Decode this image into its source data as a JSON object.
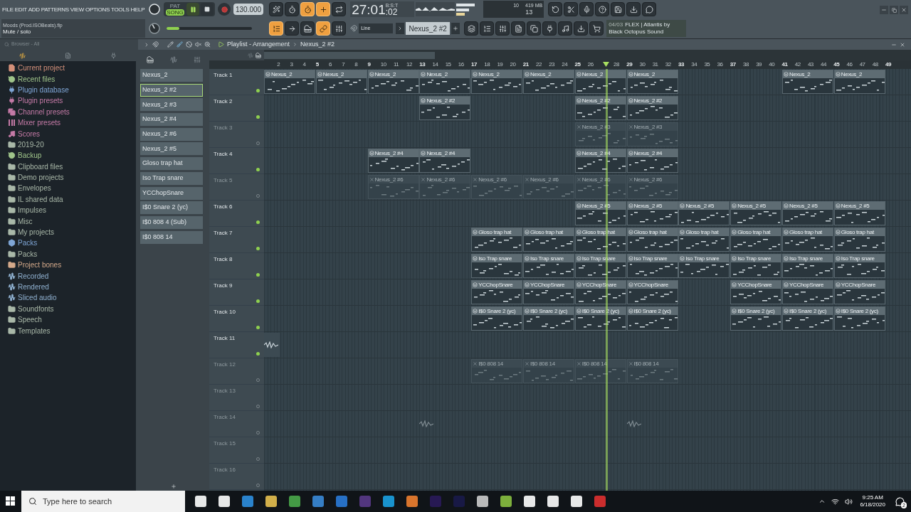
{
  "menu": [
    "FILE",
    "EDIT",
    "ADD",
    "PATTERNS",
    "VIEW",
    "OPTIONS",
    "TOOLS",
    "HELP"
  ],
  "hint": {
    "title": "Moods (Prod.ISOBeats).flp",
    "text": "Mute / solo"
  },
  "transport": {
    "pat_label": "PAT",
    "song_label": "SONG",
    "song_selected": true,
    "playing": true,
    "recording": false,
    "tempo": "130.000"
  },
  "record_toggles": [
    {
      "on": false
    },
    {
      "on": false
    },
    {
      "on": true
    },
    {
      "on": true
    },
    {
      "on": false
    }
  ],
  "time": {
    "main": "27:01",
    "sub": ":02",
    "unit": "B:S:T"
  },
  "monitor": {
    "voices": "10",
    "memory": "419 MB",
    "cpu": "13"
  },
  "master_pitch": {
    "level": 0.4
  },
  "master_volume": {
    "level": 0.15
  },
  "view_toggles": [
    {
      "on": true
    },
    {
      "on": false
    },
    {
      "on": false
    },
    {
      "on": true
    },
    {
      "on": false
    }
  ],
  "snap": "Line",
  "pattern": "Nexus_2 #2",
  "news": {
    "date": "04/03",
    "title": "FLEX | Atlantis by",
    "subtitle": "Black Octopus Sound"
  },
  "browser": {
    "title": "Browser - All",
    "items": [
      {
        "label": "Current project",
        "kind": "project",
        "color": "#d4907a"
      },
      {
        "label": "Recent files",
        "kind": "history",
        "color": "#9fc48a"
      },
      {
        "label": "Plugin database",
        "kind": "plugin",
        "color": "#7fa6d6"
      },
      {
        "label": "Plugin presets",
        "kind": "plugin",
        "color": "#c47aa6"
      },
      {
        "label": "Channel presets",
        "kind": "channel",
        "color": "#c47aa6"
      },
      {
        "label": "Mixer presets",
        "kind": "mixer",
        "color": "#c47aa6"
      },
      {
        "label": "Scores",
        "kind": "score",
        "color": "#c47aa6"
      },
      {
        "label": "2019-20",
        "kind": "folder",
        "color": "#a9b8a8"
      },
      {
        "label": "Backup",
        "kind": "history",
        "color": "#9fc48a"
      },
      {
        "label": "Clipboard files",
        "kind": "folder",
        "color": "#a9b8a8"
      },
      {
        "label": "Demo projects",
        "kind": "folder",
        "color": "#a9b8a8"
      },
      {
        "label": "Envelopes",
        "kind": "folder",
        "color": "#a9b8a8"
      },
      {
        "label": "IL shared data",
        "kind": "folder",
        "color": "#a9b8a8"
      },
      {
        "label": "Impulses",
        "kind": "folder",
        "color": "#a9b8a8"
      },
      {
        "label": "Misc",
        "kind": "folder",
        "color": "#a9b8a8"
      },
      {
        "label": "My projects",
        "kind": "folder",
        "color": "#a9b8a8"
      },
      {
        "label": "Packs",
        "kind": "packs",
        "color": "#7fa6d6"
      },
      {
        "label": "Packs",
        "kind": "folder",
        "color": "#a9b8a8"
      },
      {
        "label": "Project bones",
        "kind": "folder",
        "color": "#d4a98a"
      },
      {
        "label": "Recorded",
        "kind": "audio",
        "color": "#8fb0cf"
      },
      {
        "label": "Rendered",
        "kind": "audio",
        "color": "#8fb0cf"
      },
      {
        "label": "Sliced audio",
        "kind": "audio",
        "color": "#8fb0cf"
      },
      {
        "label": "Soundfonts",
        "kind": "folder",
        "color": "#a9b8a8"
      },
      {
        "label": "Speech",
        "kind": "folder",
        "color": "#a9b8a8"
      },
      {
        "label": "Templates",
        "kind": "folder",
        "color": "#a9b8a8"
      }
    ]
  },
  "patterns": [
    {
      "label": "Nexus_2",
      "selected": false
    },
    {
      "label": "Nexus_2 #2",
      "selected": true
    },
    {
      "label": "Nexus_2 #3",
      "selected": false
    },
    {
      "label": "Nexus_2 #4",
      "selected": false
    },
    {
      "label": "Nexus_2 #6",
      "selected": false
    },
    {
      "label": "Nexus_2 #5",
      "selected": false
    },
    {
      "label": "Gloso trap hat",
      "selected": false
    },
    {
      "label": "Iso Trap snare",
      "selected": false
    },
    {
      "label": "YCChopSnare",
      "selected": false
    },
    {
      "label": "I$0 Snare 2 (yc)",
      "selected": false
    },
    {
      "label": "I$0 808 4 (Sub)",
      "selected": false
    },
    {
      "label": "I$0 808 14",
      "selected": false
    }
  ],
  "playlist": {
    "title": "Playlist - Arrangement",
    "pattern": "Nexus_2 #2",
    "ruler": [
      {
        "kind": "number",
        "label": "2"
      },
      {
        "kind": "number",
        "label": "3"
      },
      {
        "kind": "number",
        "label": "4"
      },
      {
        "kind": "number",
        "label": "5"
      },
      {
        "kind": "number",
        "label": "6"
      },
      {
        "kind": "number",
        "label": "7"
      },
      {
        "kind": "number",
        "label": "8"
      },
      {
        "kind": "number",
        "label": "9"
      },
      {
        "kind": "number",
        "label": "10"
      },
      {
        "kind": "number",
        "label": "11"
      },
      {
        "kind": "number",
        "label": "12"
      },
      {
        "kind": "number",
        "label": "13"
      },
      {
        "kind": "number",
        "label": "14"
      },
      {
        "kind": "number",
        "label": "15"
      },
      {
        "kind": "number",
        "label": "16"
      },
      {
        "kind": "number",
        "label": "17"
      },
      {
        "kind": "number",
        "label": "18"
      },
      {
        "kind": "number",
        "label": "19"
      },
      {
        "kind": "number",
        "label": "20"
      },
      {
        "kind": "number",
        "label": "21"
      },
      {
        "kind": "number",
        "label": "22"
      },
      {
        "kind": "number",
        "label": "23"
      },
      {
        "kind": "number",
        "label": "24"
      },
      {
        "kind": "number",
        "label": "25"
      },
      {
        "kind": "number",
        "label": "26"
      },
      {
        "kind": "gap"
      },
      {
        "kind": "number",
        "label": "28"
      },
      {
        "kind": "number",
        "label": "29"
      },
      {
        "kind": "number",
        "label": "30"
      },
      {
        "kind": "number",
        "label": "31"
      },
      {
        "kind": "number",
        "label": "32"
      },
      {
        "kind": "number",
        "label": "33"
      },
      {
        "kind": "number",
        "label": "34"
      },
      {
        "kind": "number",
        "label": "35"
      },
      {
        "kind": "number",
        "label": "36"
      },
      {
        "kind": "number",
        "label": "37"
      },
      {
        "kind": "number",
        "label": "38"
      },
      {
        "kind": "number",
        "label": "39"
      },
      {
        "kind": "number",
        "label": "40"
      },
      {
        "kind": "number",
        "label": "41"
      },
      {
        "kind": "number",
        "label": "42"
      },
      {
        "kind": "number",
        "label": "43"
      },
      {
        "kind": "number",
        "label": "44"
      },
      {
        "kind": "number",
        "label": "45"
      },
      {
        "kind": "number",
        "label": "46"
      },
      {
        "kind": "number",
        "label": "47"
      },
      {
        "kind": "number",
        "label": "48"
      },
      {
        "kind": "number",
        "label": "49"
      }
    ],
    "playhead": {
      "level": 0.528
    },
    "tracks": [
      {
        "name": "Track 1",
        "muted": false,
        "slots": [
          {
            "kind": "pattern",
            "label": "Nexus_2",
            "muted": false
          },
          {
            "kind": "pattern",
            "label": "Nexus_2",
            "muted": false
          },
          {
            "kind": "pattern",
            "label": "Nexus_2",
            "muted": false
          },
          {
            "kind": "pattern",
            "label": "Nexus_2",
            "muted": false
          },
          {
            "kind": "pattern",
            "label": "Nexus_2",
            "muted": false
          },
          {
            "kind": "pattern",
            "label": "Nexus_2",
            "muted": false
          },
          {
            "kind": "pattern",
            "label": "Nexus_2",
            "muted": false
          },
          {
            "kind": "pattern",
            "label": "Nexus_2",
            "muted": false
          },
          {
            "kind": "empty"
          },
          {
            "kind": "empty"
          },
          {
            "kind": "pattern",
            "label": "Nexus_2",
            "muted": false
          },
          {
            "kind": "pattern",
            "label": "Nexus_2",
            "muted": false
          }
        ]
      },
      {
        "name": "Track 2",
        "muted": false,
        "slots": [
          {
            "kind": "empty"
          },
          {
            "kind": "empty"
          },
          {
            "kind": "empty"
          },
          {
            "kind": "pattern",
            "label": "Nexus_2 #2",
            "muted": false
          },
          {
            "kind": "empty"
          },
          {
            "kind": "empty"
          },
          {
            "kind": "pattern",
            "label": "Nexus_2 #2",
            "muted": false
          },
          {
            "kind": "pattern",
            "label": "Nexus_2 #2",
            "muted": false
          }
        ]
      },
      {
        "name": "Track 3",
        "muted": true,
        "slots": [
          {
            "kind": "empty"
          },
          {
            "kind": "empty"
          },
          {
            "kind": "empty"
          },
          {
            "kind": "empty"
          },
          {
            "kind": "empty"
          },
          {
            "kind": "empty"
          },
          {
            "kind": "pattern",
            "label": "Nexus_2 #3",
            "muted": true
          },
          {
            "kind": "pattern",
            "label": "Nexus_2 #3",
            "muted": true
          }
        ]
      },
      {
        "name": "Track 4",
        "muted": false,
        "slots": [
          {
            "kind": "empty"
          },
          {
            "kind": "empty"
          },
          {
            "kind": "pattern",
            "label": "Nexus_2 #4",
            "muted": false
          },
          {
            "kind": "pattern",
            "label": "Nexus_2 #4",
            "muted": false
          },
          {
            "kind": "empty"
          },
          {
            "kind": "empty"
          },
          {
            "kind": "pattern",
            "label": "Nexus_2 #4",
            "muted": false
          },
          {
            "kind": "pattern",
            "label": "Nexus_2 #4",
            "muted": false
          }
        ]
      },
      {
        "name": "Track 5",
        "muted": true,
        "slots": [
          {
            "kind": "empty"
          },
          {
            "kind": "empty"
          },
          {
            "kind": "pattern",
            "label": "Nexus_2 #6",
            "muted": true
          },
          {
            "kind": "pattern",
            "label": "Nexus_2 #6",
            "muted": true
          },
          {
            "kind": "pattern",
            "label": "Nexus_2 #6",
            "muted": true
          },
          {
            "kind": "pattern",
            "label": "Nexus_2 #6",
            "muted": true
          },
          {
            "kind": "pattern",
            "label": "Nexus_2 #6",
            "muted": true
          },
          {
            "kind": "pattern",
            "label": "Nexus_2 #6",
            "muted": true
          }
        ]
      },
      {
        "name": "Track 6",
        "muted": false,
        "slots": [
          {
            "kind": "empty"
          },
          {
            "kind": "empty"
          },
          {
            "kind": "empty"
          },
          {
            "kind": "empty"
          },
          {
            "kind": "empty"
          },
          {
            "kind": "empty"
          },
          {
            "kind": "pattern",
            "label": "Nexus_2 #5",
            "muted": false
          },
          {
            "kind": "pattern",
            "label": "Nexus_2 #5",
            "muted": false
          },
          {
            "kind": "pattern",
            "label": "Nexus_2 #5",
            "muted": false
          },
          {
            "kind": "pattern",
            "label": "Nexus_2 #5",
            "muted": false
          },
          {
            "kind": "pattern",
            "label": "Nexus_2 #5",
            "muted": false
          },
          {
            "kind": "pattern",
            "label": "Nexus_2 #5",
            "muted": false
          }
        ]
      },
      {
        "name": "Track 7",
        "muted": false,
        "slots": [
          {
            "kind": "empty"
          },
          {
            "kind": "empty"
          },
          {
            "kind": "empty"
          },
          {
            "kind": "empty"
          },
          {
            "kind": "pattern",
            "label": "Gloso trap hat",
            "muted": false
          },
          {
            "kind": "pattern",
            "label": "Gloso trap hat",
            "muted": false
          },
          {
            "kind": "pattern",
            "label": "Gloso trap hat",
            "muted": false
          },
          {
            "kind": "pattern",
            "label": "Gloso trap hat",
            "muted": false
          },
          {
            "kind": "pattern",
            "label": "Gloso trap hat",
            "muted": false
          },
          {
            "kind": "pattern",
            "label": "Gloso trap hat",
            "muted": false
          },
          {
            "kind": "pattern",
            "label": "Gloso trap hat",
            "muted": false
          },
          {
            "kind": "pattern",
            "label": "Gloso trap hat",
            "muted": false
          }
        ]
      },
      {
        "name": "Track 8",
        "muted": false,
        "slots": [
          {
            "kind": "empty"
          },
          {
            "kind": "empty"
          },
          {
            "kind": "empty"
          },
          {
            "kind": "empty"
          },
          {
            "kind": "pattern",
            "label": "Iso Trap snare",
            "muted": false
          },
          {
            "kind": "pattern",
            "label": "Iso Trap snare",
            "muted": false
          },
          {
            "kind": "pattern",
            "label": "Iso Trap snare",
            "muted": false
          },
          {
            "kind": "pattern",
            "label": "Iso Trap snare",
            "muted": false
          },
          {
            "kind": "pattern",
            "label": "Iso Trap snare",
            "muted": false
          },
          {
            "kind": "pattern",
            "label": "Iso Trap snare",
            "muted": false
          },
          {
            "kind": "pattern",
            "label": "Iso Trap snare",
            "muted": false
          },
          {
            "kind": "pattern",
            "label": "Iso Trap snare",
            "muted": false
          }
        ]
      },
      {
        "name": "Track 9",
        "muted": false,
        "slots": [
          {
            "kind": "empty"
          },
          {
            "kind": "empty"
          },
          {
            "kind": "empty"
          },
          {
            "kind": "empty"
          },
          {
            "kind": "pattern",
            "label": "YCChopSnare",
            "muted": false
          },
          {
            "kind": "pattern",
            "label": "YCChopSnare",
            "muted": false
          },
          {
            "kind": "pattern",
            "label": "YCChopSnare",
            "muted": false
          },
          {
            "kind": "pattern",
            "label": "YCChopSnare",
            "muted": false
          },
          {
            "kind": "empty"
          },
          {
            "kind": "pattern",
            "label": "YCChopSnare",
            "muted": false
          },
          {
            "kind": "pattern",
            "label": "YCChopSnare",
            "muted": false
          },
          {
            "kind": "pattern",
            "label": "YCChopSnare",
            "muted": false
          }
        ]
      },
      {
        "name": "Track 10",
        "muted": false,
        "slots": [
          {
            "kind": "empty"
          },
          {
            "kind": "empty"
          },
          {
            "kind": "empty"
          },
          {
            "kind": "empty"
          },
          {
            "kind": "pattern",
            "label": "I$0 Snare 2 (yc)",
            "muted": false
          },
          {
            "kind": "pattern",
            "label": "I$0 Snare 2 (yc)",
            "muted": false
          },
          {
            "kind": "pattern",
            "label": "I$0 Snare 2 (yc)",
            "muted": false
          },
          {
            "kind": "pattern",
            "label": "I$0 Snare 2 (yc)",
            "muted": false
          },
          {
            "kind": "empty"
          },
          {
            "kind": "pattern",
            "label": "I$0 Snare 2 (yc)",
            "muted": false
          },
          {
            "kind": "pattern",
            "label": "I$0 Snare 2 (yc)",
            "muted": false
          },
          {
            "kind": "pattern",
            "label": "I$0 Snare 2 (yc)",
            "muted": false
          }
        ]
      },
      {
        "name": "Track 11",
        "muted": false,
        "slots": [
          {
            "kind": "audio",
            "muted": false
          }
        ]
      },
      {
        "name": "Track 12",
        "muted": true,
        "slots": [
          {
            "kind": "empty"
          },
          {
            "kind": "empty"
          },
          {
            "kind": "empty"
          },
          {
            "kind": "empty"
          },
          {
            "kind": "pattern",
            "label": "I$0 808 14",
            "muted": true
          },
          {
            "kind": "pattern",
            "label": "I$0 808 14",
            "muted": true
          },
          {
            "kind": "pattern",
            "label": "I$0 808 14",
            "muted": true
          },
          {
            "kind": "pattern",
            "label": "I$0 808 14",
            "muted": true
          }
        ]
      },
      {
        "name": "Track 13",
        "muted": true
      },
      {
        "name": "Track 14",
        "muted": true,
        "slots": [
          {
            "kind": "empty"
          },
          {
            "kind": "empty"
          },
          {
            "kind": "empty"
          },
          {
            "kind": "audio",
            "muted": true
          },
          {
            "kind": "empty"
          },
          {
            "kind": "empty"
          },
          {
            "kind": "empty"
          },
          {
            "kind": "audio",
            "muted": true
          }
        ]
      },
      {
        "name": "Track 15",
        "muted": true
      },
      {
        "name": "Track 16",
        "muted": true
      }
    ]
  },
  "taskbar": {
    "search_placeholder": "Type here to search",
    "time": "9:25 AM",
    "date": "6/18/2020",
    "notifications": "2"
  }
}
